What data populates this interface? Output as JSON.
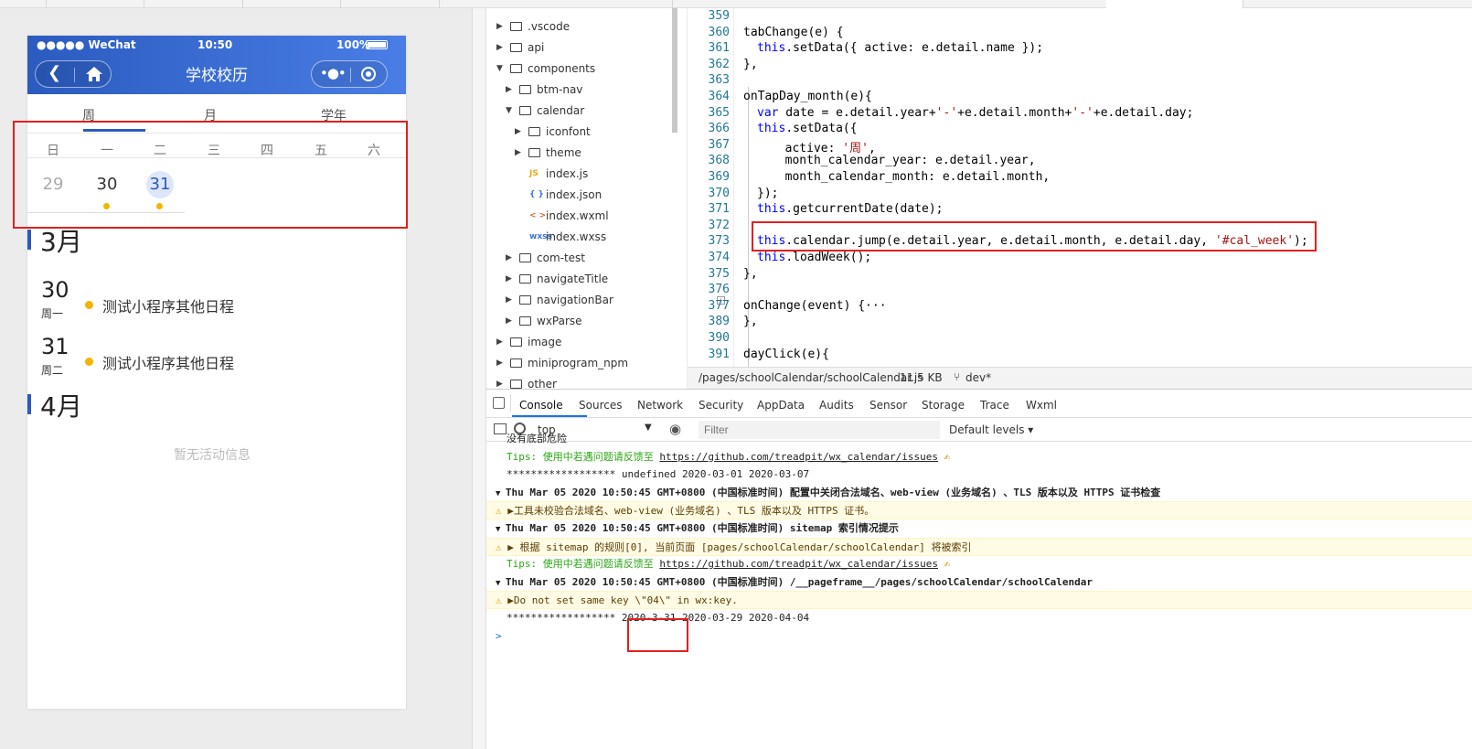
{
  "simulator": {
    "status_left": "●●●●● WeChat",
    "status_time": "10:50",
    "status_battery": "100%",
    "title": "学校校历",
    "tabs": [
      "周",
      "月",
      "学年"
    ],
    "weekdays": [
      "日",
      "一",
      "二",
      "三",
      "四",
      "五",
      "六"
    ],
    "days": [
      "29",
      "30",
      "31"
    ],
    "months": [
      "3月",
      "4月"
    ],
    "events": [
      {
        "day": "30",
        "weekday": "周一",
        "text": "测试小程序其他日程"
      },
      {
        "day": "31",
        "weekday": "周二",
        "text": "测试小程序其他日程"
      }
    ],
    "empty_text": "暂无活动信息"
  },
  "tree": [
    ".vscode",
    "api",
    "components",
    "btm-nav",
    "calendar",
    "iconfont",
    "theme",
    "index.js",
    "index.json",
    "index.wxml",
    "index.wxss",
    "com-test",
    "navigateTitle",
    "navigationBar",
    "wxParse",
    "image",
    "miniprogram_npm",
    "other"
  ],
  "tree_icons": {
    "js": "JS",
    "json": "{ }",
    "wxml": "< >",
    "wxss": "wxss"
  },
  "code": {
    "line_numbers": [
      "359",
      "360",
      "361",
      "362",
      "363",
      "364",
      "365",
      "366",
      "367",
      "368",
      "369",
      "370",
      "371",
      "372",
      "373",
      "374",
      "375",
      "376",
      "377",
      "389",
      "390",
      "391"
    ],
    "lines": [
      {
        "p": "tabChange(e) {"
      },
      {
        "k": "this",
        "p": ".setData({ active: e.detail.name });"
      },
      {
        "p": "},"
      },
      {
        "p": ""
      },
      {
        "p": "onTapDay_month(e){"
      },
      {
        "k": "var",
        "p": " date = e.detail.year+",
        "s": "'-'",
        "p2": "+e.detail.month+",
        "s2": "'-'",
        "p3": "+e.detail.day;"
      },
      {
        "k": "this",
        "p": ".setData({"
      },
      {
        "p": "  active: ",
        "s": "'周'",
        "p2": ","
      },
      {
        "p": "  month_calendar_year: e.detail.year,"
      },
      {
        "p": "  month_calendar_month: e.detail.month,"
      },
      {
        "p": "});"
      },
      {
        "k": "this",
        "p": ".getcurrentDate(date);"
      },
      {
        "p": ""
      },
      {
        "k": "this",
        "p": ".calendar.jump(e.detail.year, e.detail.month, e.detail.day, ",
        "s": "'#cal_week'",
        "p2": ");"
      },
      {
        "k": "this",
        "p": ".loadWeek();"
      },
      {
        "p": "},"
      },
      {
        "p": ""
      },
      {
        "p": "onChange(event) {···"
      },
      {
        "p": "},"
      },
      {
        "p": ""
      },
      {
        "p": "dayClick(e){"
      }
    ]
  },
  "statusbar": {
    "path": "/pages/schoolCalendar/schoolCalendar.js",
    "size": "11.5 KB",
    "branch": "dev*"
  },
  "devtools": {
    "tabs": [
      "Console",
      "Sources",
      "Network",
      "Security",
      "AppData",
      "Audits",
      "Sensor",
      "Storage",
      "Trace",
      "Wxml"
    ],
    "context": "top",
    "filter_placeholder": "Filter",
    "levels": "Default levels ▾",
    "console": [
      {
        "t": "没有底部危险"
      },
      {
        "tips": "Tips: 使用中若遇问题请反馈至 ",
        "link": "https://github.com/treadpit/wx_calendar/issues",
        "emoji": "✍"
      },
      {
        "t": "****************** undefined 2020-03-01 2020-03-07"
      },
      {
        "grp": "Thu Mar 05 2020 10:50:45 GMT+0800 (中国标准时间) 配置中关闭合法域名、web-view (业务域名) 、TLS 版本以及 HTTPS 证书检查"
      },
      {
        "warn": "▶工具未校验合法域名、web-view (业务域名) 、TLS 版本以及 HTTPS 证书。"
      },
      {
        "grp": "Thu Mar 05 2020 10:50:45 GMT+0800 (中国标准时间) sitemap 索引情况提示"
      },
      {
        "warn": "▶ 根据 sitemap 的规则[0], 当前页面 [pages/schoolCalendar/schoolCalendar] 将被索引"
      },
      {
        "tips": "Tips: 使用中若遇问题请反馈至 ",
        "link": "https://github.com/treadpit/wx_calendar/issues",
        "emoji": "✍"
      },
      {
        "grp": "Thu Mar 05 2020 10:50:45 GMT+0800 (中国标准时间) /__pageframe__/pages/schoolCalendar/schoolCalendar"
      },
      {
        "warn": "▶Do not set same key \\\"04\\\" in wx:key."
      },
      {
        "t": "****************** 2020-3-31 2020-03-29 2020-04-04"
      }
    ],
    "prompt": ">"
  }
}
